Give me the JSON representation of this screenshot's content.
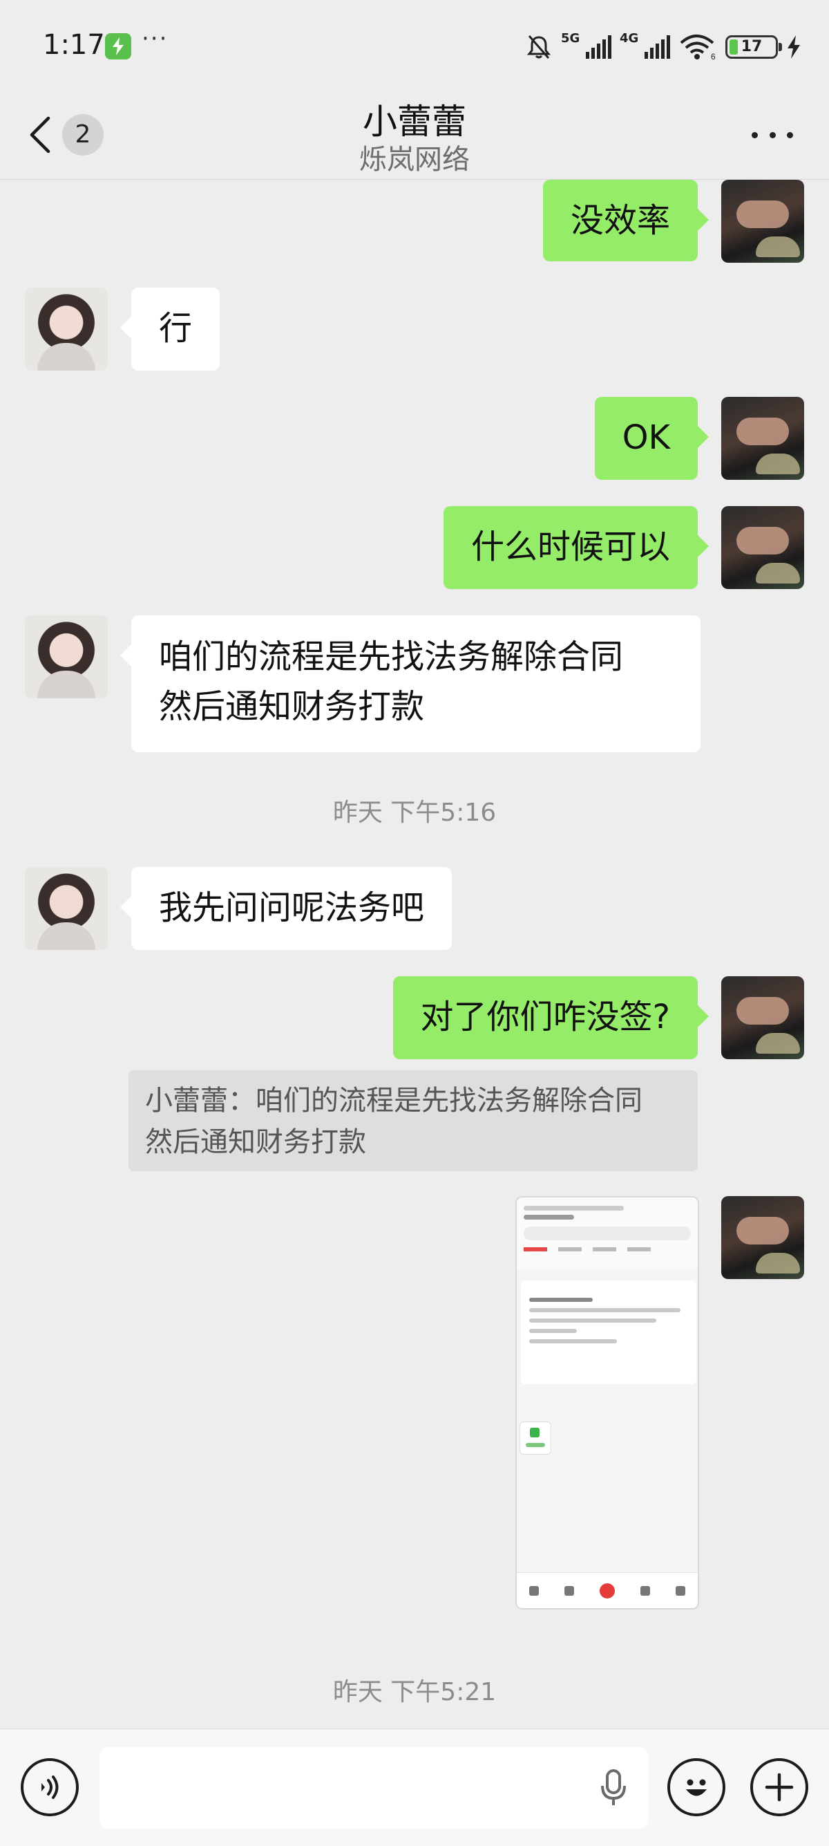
{
  "status_bar": {
    "time": "1:17",
    "more_dots": "···",
    "network_1": "5G",
    "network_2": "4G",
    "battery_level": "17"
  },
  "header": {
    "unread_count": "2",
    "title": "小蕾蕾",
    "subtitle": "烁岚网络"
  },
  "messages": [
    {
      "side": "right",
      "text": "没效率"
    },
    {
      "side": "left",
      "text": "行"
    },
    {
      "side": "right",
      "text": "OK"
    },
    {
      "side": "right",
      "text": "什么时候可以"
    },
    {
      "side": "left",
      "line1": "咱们的流程是先找法务解除合同",
      "line2": "然后通知财务打款"
    },
    {
      "type": "time",
      "text": "昨天 下午5:16"
    },
    {
      "side": "left",
      "text": "我先问问呢法务吧"
    },
    {
      "side": "right",
      "text": "对了你们咋没签?"
    },
    {
      "type": "quote",
      "line1": "小蕾蕾：咱们的流程是先找法务解除合同",
      "line2": "然后通知财务打款"
    },
    {
      "side": "right",
      "type": "image"
    },
    {
      "type": "time",
      "text": "昨天 下午5:21"
    }
  ],
  "colors": {
    "background": "#ededed",
    "my_bubble": "#95ec69",
    "their_bubble": "#ffffff",
    "quote_bg": "#dedede"
  },
  "icons": [
    "back-icon",
    "more-icon",
    "voice-icon",
    "microphone-icon",
    "emoji-icon",
    "plus-icon"
  ]
}
